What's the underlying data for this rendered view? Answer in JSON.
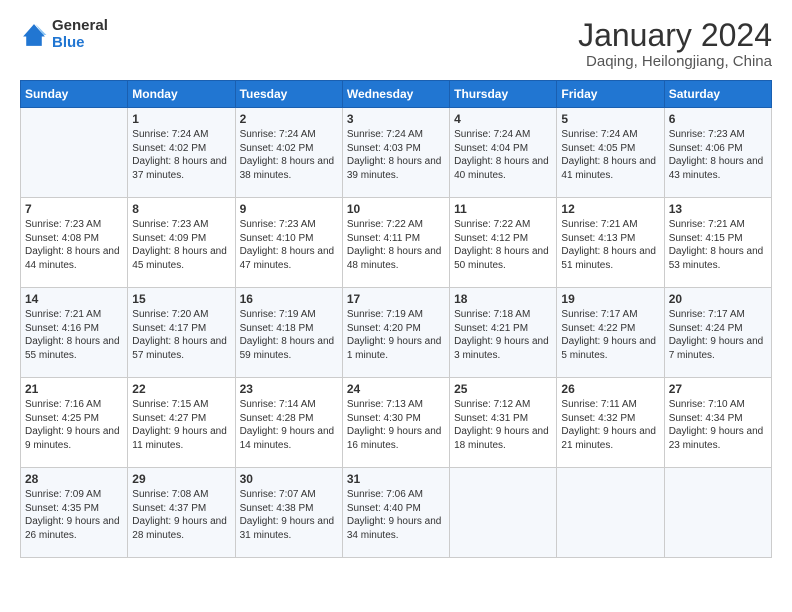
{
  "logo": {
    "general": "General",
    "blue": "Blue"
  },
  "title": "January 2024",
  "subtitle": "Daqing, Heilongjiang, China",
  "days_header": [
    "Sunday",
    "Monday",
    "Tuesday",
    "Wednesday",
    "Thursday",
    "Friday",
    "Saturday"
  ],
  "weeks": [
    [
      {
        "day": "",
        "sunrise": "",
        "sunset": "",
        "daylight": ""
      },
      {
        "day": "1",
        "sunrise": "Sunrise: 7:24 AM",
        "sunset": "Sunset: 4:02 PM",
        "daylight": "Daylight: 8 hours and 37 minutes."
      },
      {
        "day": "2",
        "sunrise": "Sunrise: 7:24 AM",
        "sunset": "Sunset: 4:02 PM",
        "daylight": "Daylight: 8 hours and 38 minutes."
      },
      {
        "day": "3",
        "sunrise": "Sunrise: 7:24 AM",
        "sunset": "Sunset: 4:03 PM",
        "daylight": "Daylight: 8 hours and 39 minutes."
      },
      {
        "day": "4",
        "sunrise": "Sunrise: 7:24 AM",
        "sunset": "Sunset: 4:04 PM",
        "daylight": "Daylight: 8 hours and 40 minutes."
      },
      {
        "day": "5",
        "sunrise": "Sunrise: 7:24 AM",
        "sunset": "Sunset: 4:05 PM",
        "daylight": "Daylight: 8 hours and 41 minutes."
      },
      {
        "day": "6",
        "sunrise": "Sunrise: 7:23 AM",
        "sunset": "Sunset: 4:06 PM",
        "daylight": "Daylight: 8 hours and 43 minutes."
      }
    ],
    [
      {
        "day": "7",
        "sunrise": "Sunrise: 7:23 AM",
        "sunset": "Sunset: 4:08 PM",
        "daylight": "Daylight: 8 hours and 44 minutes."
      },
      {
        "day": "8",
        "sunrise": "Sunrise: 7:23 AM",
        "sunset": "Sunset: 4:09 PM",
        "daylight": "Daylight: 8 hours and 45 minutes."
      },
      {
        "day": "9",
        "sunrise": "Sunrise: 7:23 AM",
        "sunset": "Sunset: 4:10 PM",
        "daylight": "Daylight: 8 hours and 47 minutes."
      },
      {
        "day": "10",
        "sunrise": "Sunrise: 7:22 AM",
        "sunset": "Sunset: 4:11 PM",
        "daylight": "Daylight: 8 hours and 48 minutes."
      },
      {
        "day": "11",
        "sunrise": "Sunrise: 7:22 AM",
        "sunset": "Sunset: 4:12 PM",
        "daylight": "Daylight: 8 hours and 50 minutes."
      },
      {
        "day": "12",
        "sunrise": "Sunrise: 7:21 AM",
        "sunset": "Sunset: 4:13 PM",
        "daylight": "Daylight: 8 hours and 51 minutes."
      },
      {
        "day": "13",
        "sunrise": "Sunrise: 7:21 AM",
        "sunset": "Sunset: 4:15 PM",
        "daylight": "Daylight: 8 hours and 53 minutes."
      }
    ],
    [
      {
        "day": "14",
        "sunrise": "Sunrise: 7:21 AM",
        "sunset": "Sunset: 4:16 PM",
        "daylight": "Daylight: 8 hours and 55 minutes."
      },
      {
        "day": "15",
        "sunrise": "Sunrise: 7:20 AM",
        "sunset": "Sunset: 4:17 PM",
        "daylight": "Daylight: 8 hours and 57 minutes."
      },
      {
        "day": "16",
        "sunrise": "Sunrise: 7:19 AM",
        "sunset": "Sunset: 4:18 PM",
        "daylight": "Daylight: 8 hours and 59 minutes."
      },
      {
        "day": "17",
        "sunrise": "Sunrise: 7:19 AM",
        "sunset": "Sunset: 4:20 PM",
        "daylight": "Daylight: 9 hours and 1 minute."
      },
      {
        "day": "18",
        "sunrise": "Sunrise: 7:18 AM",
        "sunset": "Sunset: 4:21 PM",
        "daylight": "Daylight: 9 hours and 3 minutes."
      },
      {
        "day": "19",
        "sunrise": "Sunrise: 7:17 AM",
        "sunset": "Sunset: 4:22 PM",
        "daylight": "Daylight: 9 hours and 5 minutes."
      },
      {
        "day": "20",
        "sunrise": "Sunrise: 7:17 AM",
        "sunset": "Sunset: 4:24 PM",
        "daylight": "Daylight: 9 hours and 7 minutes."
      }
    ],
    [
      {
        "day": "21",
        "sunrise": "Sunrise: 7:16 AM",
        "sunset": "Sunset: 4:25 PM",
        "daylight": "Daylight: 9 hours and 9 minutes."
      },
      {
        "day": "22",
        "sunrise": "Sunrise: 7:15 AM",
        "sunset": "Sunset: 4:27 PM",
        "daylight": "Daylight: 9 hours and 11 minutes."
      },
      {
        "day": "23",
        "sunrise": "Sunrise: 7:14 AM",
        "sunset": "Sunset: 4:28 PM",
        "daylight": "Daylight: 9 hours and 14 minutes."
      },
      {
        "day": "24",
        "sunrise": "Sunrise: 7:13 AM",
        "sunset": "Sunset: 4:30 PM",
        "daylight": "Daylight: 9 hours and 16 minutes."
      },
      {
        "day": "25",
        "sunrise": "Sunrise: 7:12 AM",
        "sunset": "Sunset: 4:31 PM",
        "daylight": "Daylight: 9 hours and 18 minutes."
      },
      {
        "day": "26",
        "sunrise": "Sunrise: 7:11 AM",
        "sunset": "Sunset: 4:32 PM",
        "daylight": "Daylight: 9 hours and 21 minutes."
      },
      {
        "day": "27",
        "sunrise": "Sunrise: 7:10 AM",
        "sunset": "Sunset: 4:34 PM",
        "daylight": "Daylight: 9 hours and 23 minutes."
      }
    ],
    [
      {
        "day": "28",
        "sunrise": "Sunrise: 7:09 AM",
        "sunset": "Sunset: 4:35 PM",
        "daylight": "Daylight: 9 hours and 26 minutes."
      },
      {
        "day": "29",
        "sunrise": "Sunrise: 7:08 AM",
        "sunset": "Sunset: 4:37 PM",
        "daylight": "Daylight: 9 hours and 28 minutes."
      },
      {
        "day": "30",
        "sunrise": "Sunrise: 7:07 AM",
        "sunset": "Sunset: 4:38 PM",
        "daylight": "Daylight: 9 hours and 31 minutes."
      },
      {
        "day": "31",
        "sunrise": "Sunrise: 7:06 AM",
        "sunset": "Sunset: 4:40 PM",
        "daylight": "Daylight: 9 hours and 34 minutes."
      },
      {
        "day": "",
        "sunrise": "",
        "sunset": "",
        "daylight": ""
      },
      {
        "day": "",
        "sunrise": "",
        "sunset": "",
        "daylight": ""
      },
      {
        "day": "",
        "sunrise": "",
        "sunset": "",
        "daylight": ""
      }
    ]
  ]
}
